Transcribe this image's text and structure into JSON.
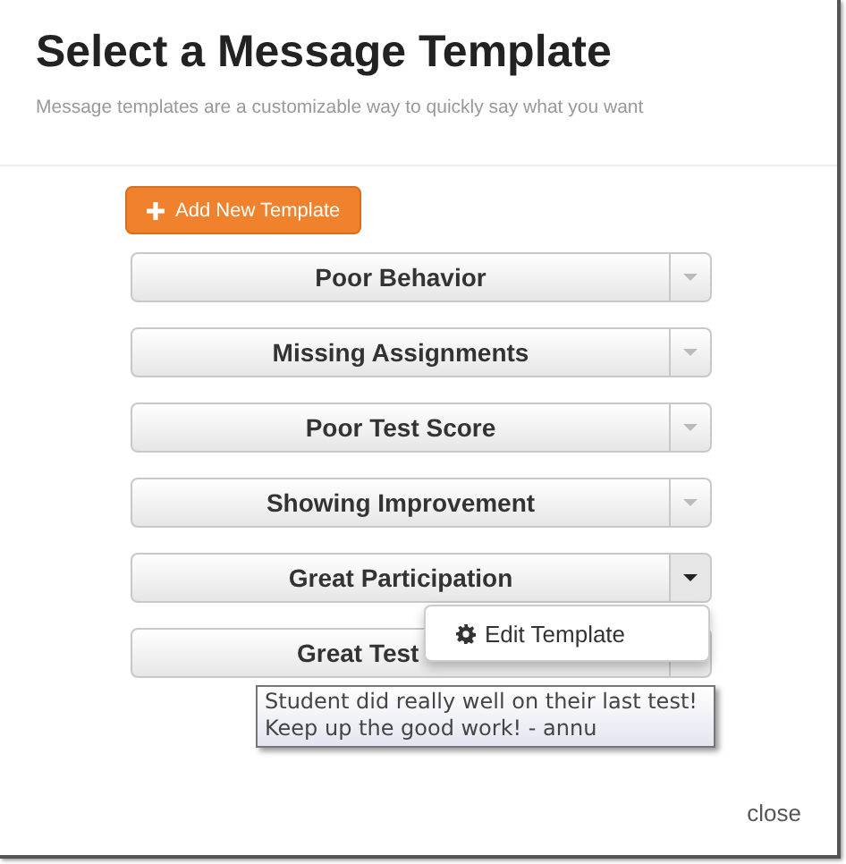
{
  "dialog": {
    "title": "Select a Message Template",
    "subtitle": "Message templates are a customizable way to quickly say what you want"
  },
  "add_button": {
    "label": "Add New Template"
  },
  "templates": [
    {
      "label": "Poor Behavior",
      "open": false,
      "kind": "normal"
    },
    {
      "label": "Missing Assignments",
      "open": false,
      "kind": "normal"
    },
    {
      "label": "Poor Test Score",
      "open": false,
      "kind": "normal"
    },
    {
      "label": "Showing Improvement",
      "open": false,
      "kind": "normal"
    },
    {
      "label": "Great Participation",
      "open": true,
      "kind": "normal",
      "menu": [
        "Edit Template"
      ]
    },
    {
      "label": "Great Test",
      "open": false,
      "kind": "covered"
    }
  ],
  "tooltip": "Student did really well on their last test! Keep up the good work! - annu",
  "close": "close"
}
